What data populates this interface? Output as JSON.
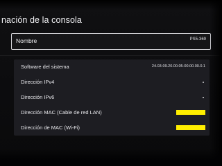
{
  "header": {
    "title": "nación de la consola"
  },
  "console_name": {
    "label": "Nombre",
    "value": "PS5-369"
  },
  "info_rows": [
    {
      "label": "Software del sistema",
      "value": "24.03-09.20.00.05-00.00.00.0.1"
    },
    {
      "label": "Dirección IPv4",
      "value": ""
    },
    {
      "label": "Dirección IPv6",
      "value": ""
    },
    {
      "label": "Dirección MAC (Cable de red LAN)",
      "value": ""
    },
    {
      "label": "Dirección de MAC (Wi-Fi)",
      "value": ""
    }
  ],
  "colors": {
    "redaction": "#ffee00",
    "panel": "#1d1d22",
    "background": "#0b0b0d"
  }
}
